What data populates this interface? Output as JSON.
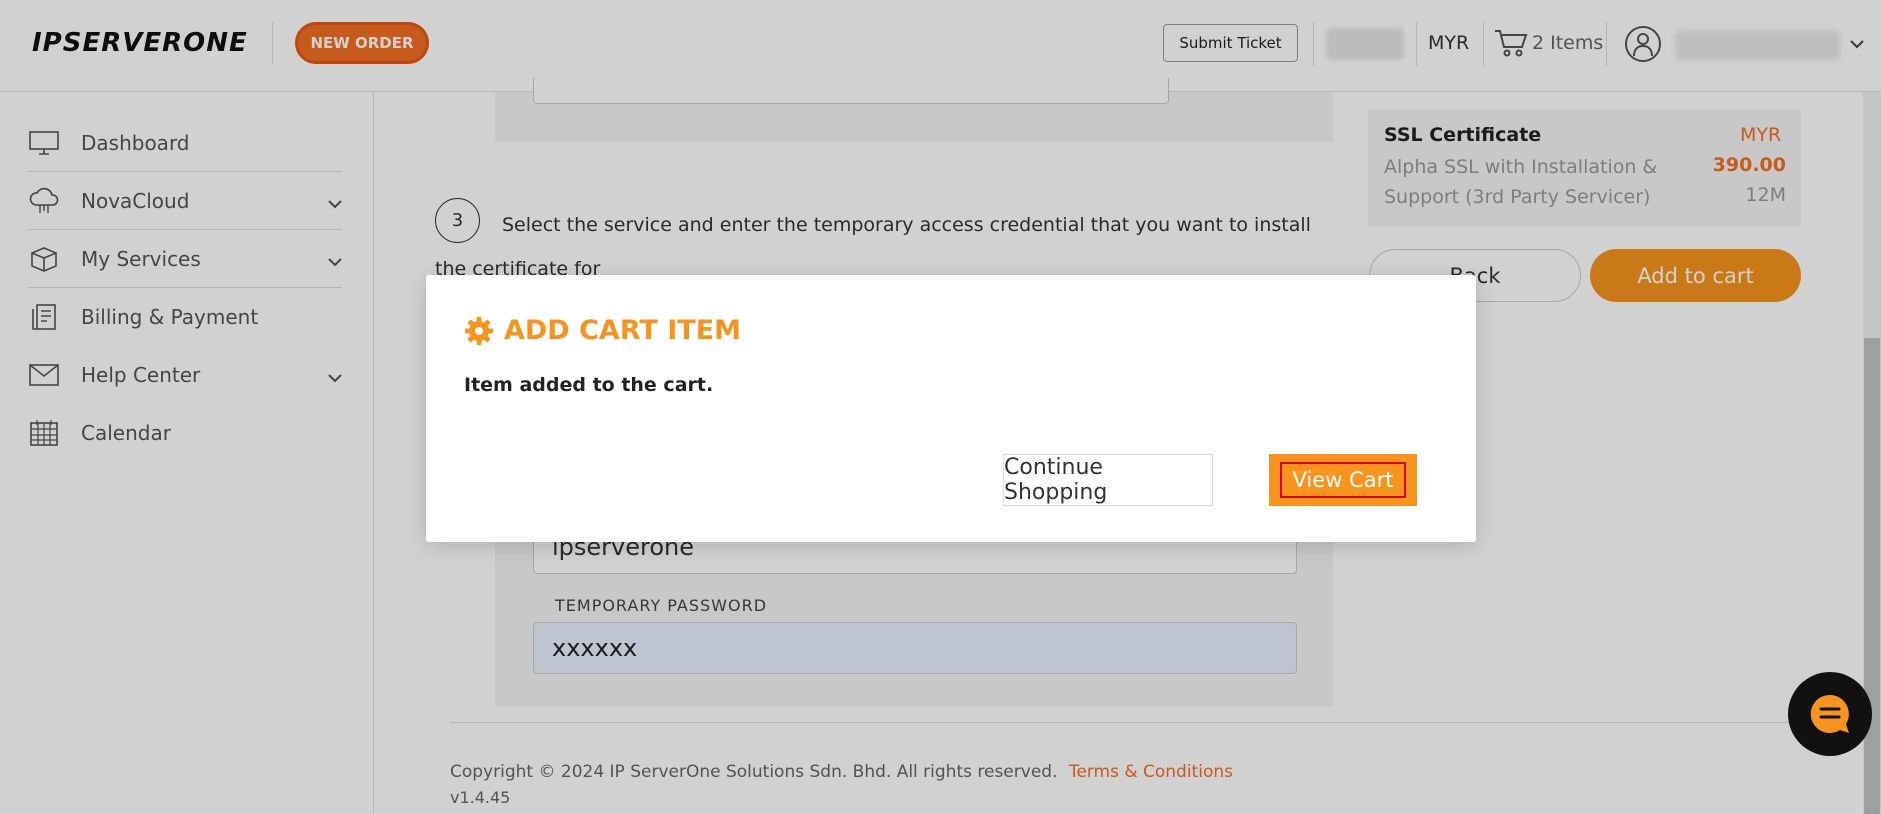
{
  "header": {
    "logo": "IPSERVERONE",
    "new_order": "NEW ORDER",
    "submit_ticket": "Submit Ticket",
    "currency": "MYR",
    "cart_count": "2 Items"
  },
  "sidebar": {
    "items": [
      {
        "label": "Dashboard",
        "icon": "monitor-icon"
      },
      {
        "label": "NovaCloud",
        "icon": "cloud-icon"
      },
      {
        "label": "My Services",
        "icon": "box-icon"
      },
      {
        "label": "Billing & Payment",
        "icon": "receipt-icon"
      },
      {
        "label": "Help Center",
        "icon": "envelope-icon"
      },
      {
        "label": "Calendar",
        "icon": "calendar-icon"
      }
    ]
  },
  "main": {
    "step_number": "3",
    "step_text": "Select the service and enter the temporary access credential that you want to install the certificate for",
    "username_value": "ipserverone",
    "password_label": "TEMPORARY PASSWORD",
    "password_value": "xxxxxx"
  },
  "summary": {
    "title": "SSL Certificate",
    "currency": "MYR",
    "description": "Alpha SSL with Installation & Support (3rd Party Servicer)",
    "price": "390.00",
    "term": "12M",
    "back_label": "Back",
    "add_label": "Add to cart"
  },
  "footer": {
    "copyright": "Copyright © 2024 IP ServerOne Solutions Sdn. Bhd. All rights reserved.",
    "terms": "Terms & Conditions",
    "version": "v1.4.45"
  },
  "modal": {
    "title": "ADD CART ITEM",
    "message": "Item added to the cart.",
    "continue_label": "Continue Shopping",
    "view_cart_label": "View Cart"
  },
  "colors": {
    "accent": "#f7941d",
    "brand_orange": "#f36f21",
    "highlight_border": "#e00000"
  }
}
